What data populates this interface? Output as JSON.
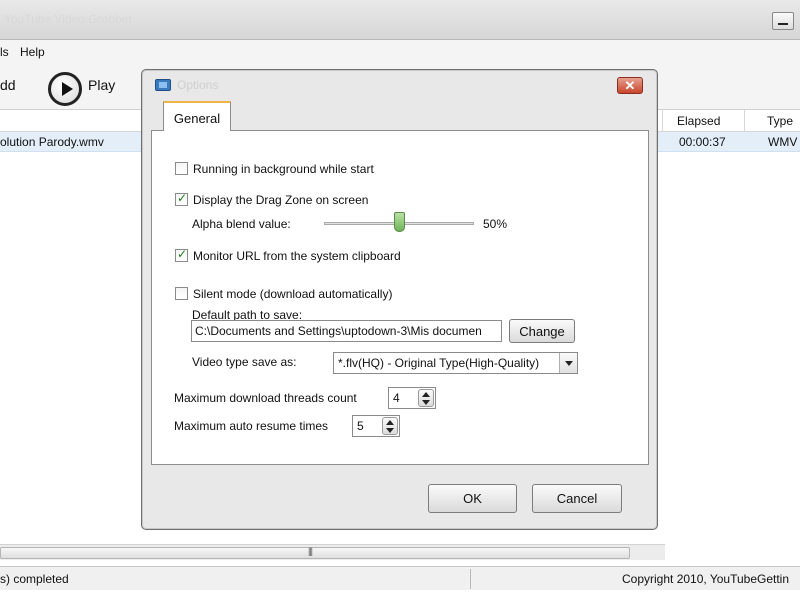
{
  "app": {
    "title": "YouTube Video Grabber"
  },
  "menu": {
    "items": [
      "ls",
      "Help"
    ]
  },
  "toolbar": {
    "add_label": "dd",
    "play_label": "Play"
  },
  "list": {
    "columns": [
      "Elapsed",
      "Type"
    ],
    "rows": [
      {
        "name": "olution Parody.wmv",
        "elapsed": "00:00:37",
        "type": "WMV"
      }
    ]
  },
  "status": {
    "left": "s) completed",
    "right": "Copyright 2010, YouTubeGettin"
  },
  "dialog": {
    "title": "Options",
    "close_glyph": "✕",
    "tab_label": "General",
    "running_background": {
      "label": "Running in background while start",
      "checked": false
    },
    "drag_zone": {
      "label": "Display the Drag Zone on screen",
      "checked": true
    },
    "alpha_blend": {
      "label": "Alpha blend value:",
      "value_text": "50%",
      "value_fraction": 0.5
    },
    "monitor_clipboard": {
      "label": "Monitor URL from the system clipboard",
      "checked": true
    },
    "silent_mode": {
      "label": "Silent mode (download automatically)",
      "checked": false
    },
    "default_path": {
      "label": "Default path to save:",
      "value": "C:\\Documents and Settings\\uptodown-3\\Mis documen",
      "change_label": "Change"
    },
    "video_type": {
      "label": "Video type save as:",
      "selected": "*.flv(HQ) - Original Type(High-Quality)"
    },
    "max_threads": {
      "label": "Maximum download threads count",
      "value": "4"
    },
    "max_resume": {
      "label": "Maximum auto resume times",
      "value": "5"
    },
    "ok_label": "OK",
    "cancel_label": "Cancel"
  }
}
